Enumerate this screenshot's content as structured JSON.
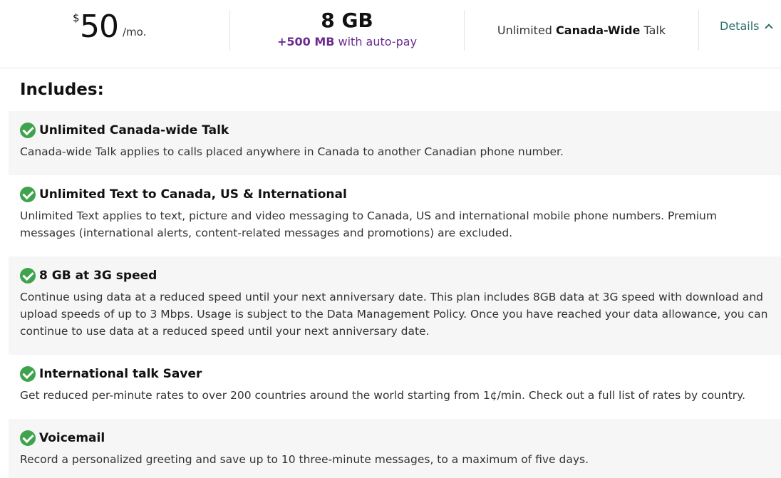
{
  "plan": {
    "currency": "$",
    "price": "50",
    "per": "/mo.",
    "data": "8 GB",
    "bonus_bold": "+500 MB",
    "bonus_rest": " with auto-pay",
    "talk_pre": "Unlimited ",
    "talk_bold": "Canada-Wide",
    "talk_post": " Talk",
    "details_label": "Details"
  },
  "includes_heading": "Includes:",
  "features": [
    {
      "title": "Unlimited Canada-wide Talk",
      "desc": [
        "Canada-wide Talk applies to calls placed anywhere in Canada to another Canadian phone number."
      ]
    },
    {
      "title": "Unlimited Text to Canada, US & International",
      "desc": [
        "Unlimited Text applies to text, picture and video messaging to Canada, US and international mobile phone numbers. Premium",
        "messages (international alerts, content-related messages and promotions) are excluded."
      ]
    },
    {
      "title": "8 GB at 3G speed",
      "desc": [
        "Continue using data at a reduced speed until your next anniversary date. This plan includes 8GB data at 3G speed with download and",
        "upload speeds of up to 3 Mbps. Usage is subject to the Data Management Policy. Once you have reached your data allowance, you can",
        "continue to use data at a reduced speed until your next anniversary date."
      ]
    },
    {
      "title": "International talk Saver",
      "desc": [
        "Get reduced per-minute rates to over 200 countries around the world starting from 1¢/min. Check out a full list of rates by country."
      ]
    },
    {
      "title": "Voicemail",
      "desc": [
        "Record a personalized greeting and save up to 10 three-minute messages, to a maximum of five days."
      ]
    }
  ],
  "colors": {
    "accent": "#6a2c91",
    "link": "#2b6e6a",
    "check": "#3fa34d"
  },
  "icons": {
    "feature": "check-circle-icon",
    "details": "chevron-up-icon"
  }
}
